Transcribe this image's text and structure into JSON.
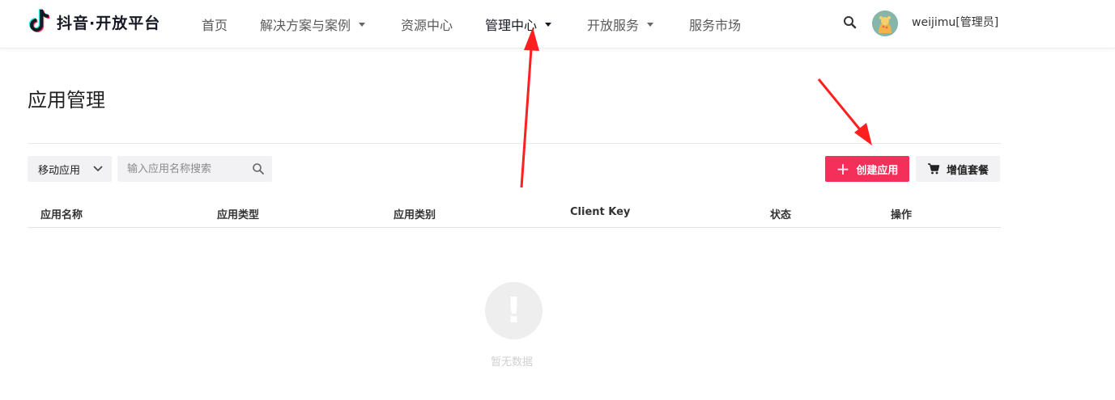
{
  "brand": {
    "name": "抖音·开放平台"
  },
  "nav": {
    "items": [
      {
        "label": "首页"
      },
      {
        "label": "解决方案与案例"
      },
      {
        "label": "资源中心"
      },
      {
        "label": "管理中心"
      },
      {
        "label": "开放服务"
      },
      {
        "label": "服务市场"
      }
    ],
    "active": "管理中心"
  },
  "user": {
    "name": "weijimu[管理员]"
  },
  "page": {
    "title": "应用管理"
  },
  "toolbar": {
    "platform_select": "移动应用",
    "search_placeholder": "输入应用名称搜索",
    "create_label": "创建应用",
    "package_label": "增值套餐"
  },
  "table": {
    "columns": [
      "应用名称",
      "应用类型",
      "应用类别",
      "Client Key",
      "状态",
      "操作"
    ],
    "rows": []
  },
  "empty_state": {
    "text": "暂无数据"
  },
  "colors": {
    "accent": "#f32f5a",
    "annotation": "#ff1f1f"
  },
  "icons": [
    "douyin-logo-icon",
    "chevron-down-icon",
    "search-icon",
    "plus-icon",
    "cart-icon",
    "exclamation-icon"
  ]
}
